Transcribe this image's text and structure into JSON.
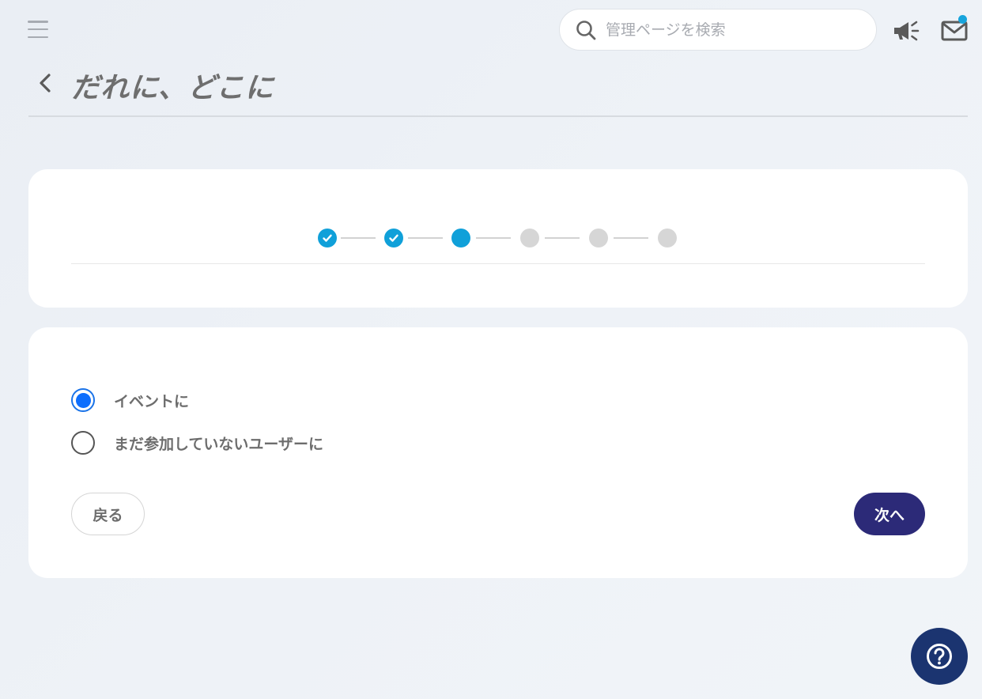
{
  "header": {
    "search_placeholder": "管理ページを検索",
    "unread_badge_color": "#17a4dc"
  },
  "page": {
    "title": "だれに、どこに"
  },
  "stepper": {
    "total_steps": 6,
    "current_step": 3,
    "steps": [
      "done",
      "done",
      "current",
      "pending",
      "pending",
      "pending"
    ],
    "active_color": "#10a0d9",
    "inactive_color": "#d6d6d6"
  },
  "form": {
    "options": [
      {
        "label": "イベントに",
        "selected": true
      },
      {
        "label": "まだ参加していないユーザーに",
        "selected": false
      }
    ],
    "back_label": "戻る",
    "next_label": "次へ",
    "next_color": "#2c2a78"
  },
  "help": {
    "icon": "question-circle-icon"
  }
}
